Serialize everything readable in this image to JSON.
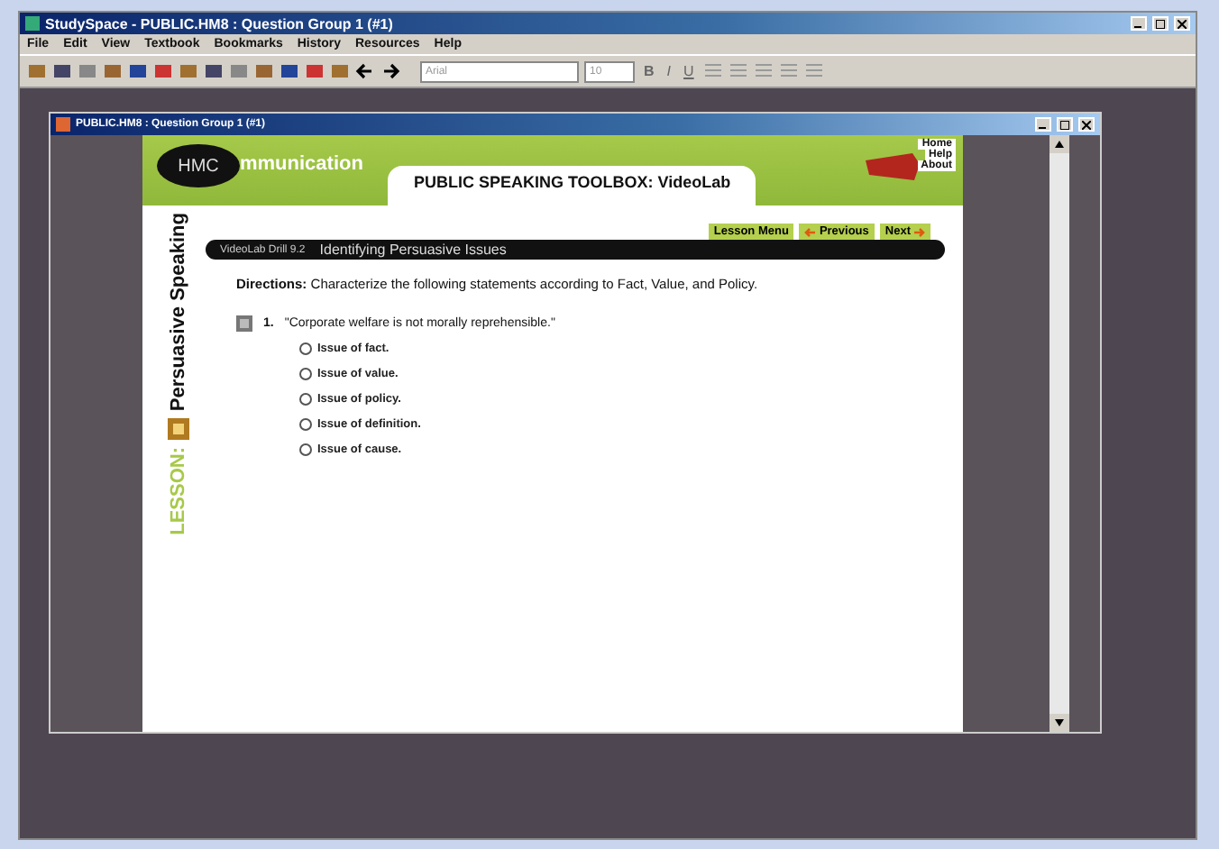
{
  "app_window": {
    "title": "StudySpace - PUBLIC.HM8 : Question Group 1 (#1)"
  },
  "menu": [
    "File",
    "Edit",
    "View",
    "Textbook",
    "Bookmarks",
    "History",
    "Resources",
    "Help"
  ],
  "toolbar": {
    "font": "Arial",
    "size": "10",
    "format": [
      "B",
      "I",
      "U"
    ]
  },
  "doc_window": {
    "title": "PUBLIC.HM8 : Question Group 1 (#1)"
  },
  "header": {
    "logo_bubble": "HMC",
    "logo_rest": "mmunication",
    "title": "PUBLIC SPEAKING TOOLBOX: VideoLab",
    "links": [
      "Home",
      "Help",
      "About"
    ]
  },
  "nav": [
    {
      "label": "Lesson Menu",
      "kind": "plain"
    },
    {
      "label": "Previous",
      "kind": "back"
    },
    {
      "label": "Next",
      "kind": "forward"
    }
  ],
  "lesson": {
    "label": "LESSON:",
    "name": "Persuasive Speaking"
  },
  "drill": {
    "number": "VideoLab Drill 9.2",
    "title": "Identifying Persuasive Issues"
  },
  "directions": "**Directions:** Characterize the following statements according to Fact, Value, and Policy.",
  "question": {
    "number": "1.",
    "text": "\"Corporate welfare is not morally reprehensible.\"",
    "options": [
      {
        "label": "Issue of fact.",
        "selected": false
      },
      {
        "label": "Issue of value.",
        "selected": false
      },
      {
        "label": "Issue of policy.",
        "selected": false
      },
      {
        "label": "Issue of definition.",
        "selected": false
      },
      {
        "label": "Issue of cause.",
        "selected": false
      }
    ]
  }
}
